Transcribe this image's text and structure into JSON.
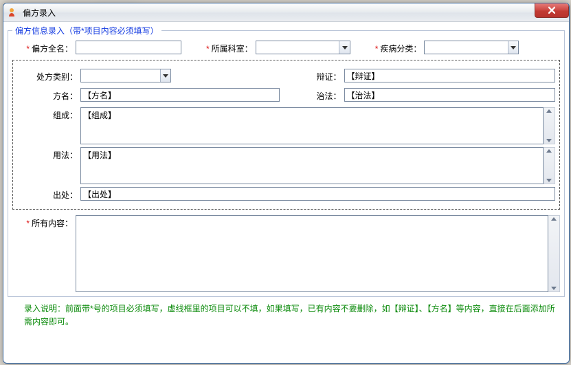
{
  "window": {
    "title": "偏方录入"
  },
  "legend": "偏方信息录入（带*项目内容必须填写）",
  "fields": {
    "fullname_label": "偏方全名：",
    "fullname_value": "",
    "dept_label": "所属科室：",
    "dept_value": "",
    "disease_label": "疾病分类：",
    "disease_value": "",
    "rx_type_label": "处方类别：",
    "rx_type_value": "",
    "bianzheng_label": "辩证：",
    "bianzheng_value": "【辩证】",
    "fangming_label": "方名：",
    "fangming_value": "【方名】",
    "zhifa_label": "治法：",
    "zhifa_value": "【治法】",
    "zucheng_label": "组成：",
    "zucheng_value": "【组成】",
    "yongfa_label": "用法：",
    "yongfa_value": "【用法】",
    "chuchu_label": "出处：",
    "chuchu_value": "【出处】",
    "all_label": "所有内容：",
    "all_value": ""
  },
  "note": "录入说明：前面带*号的项目必须填写，虚线框里的项目可以不填，如果填写，已有内容不要删除，如【辩证】、【方名】等内容，直接在后面添加所需内容即可。"
}
